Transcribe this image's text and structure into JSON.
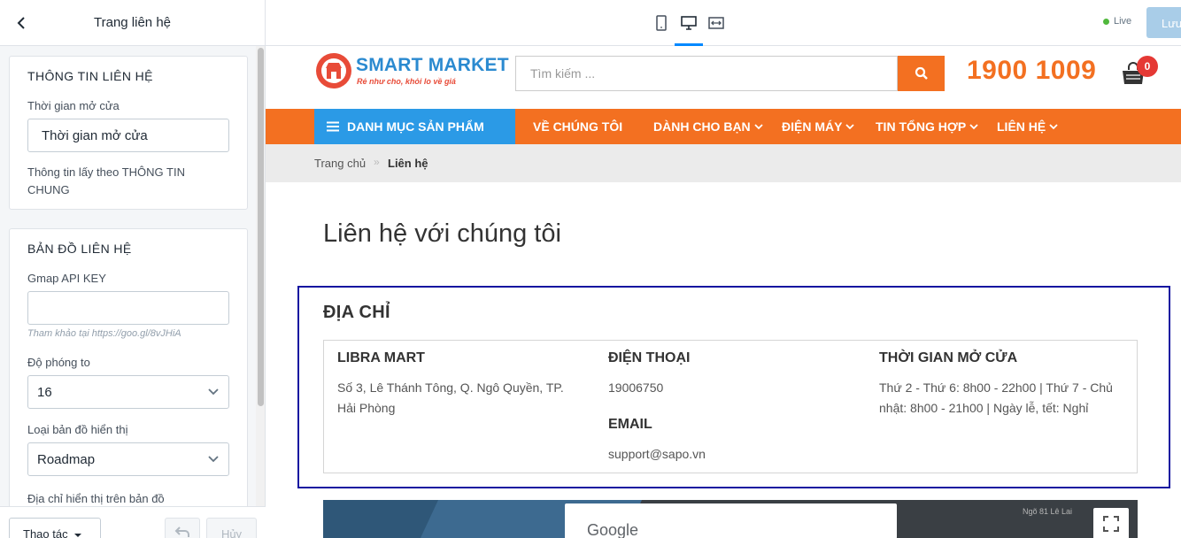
{
  "editor": {
    "header_title": "Trang liên hệ",
    "contact_info": {
      "title": "THÔNG TIN LIÊN HỆ",
      "opening_label": "Thời gian mở cửa",
      "opening_value": "Thời gian mở cửa",
      "help": "Thông tin lấy theo THÔNG TIN CHUNG"
    },
    "map": {
      "title": "BẢN ĐỒ LIÊN HỆ",
      "api_label": "Gmap API KEY",
      "api_value": "",
      "api_hint": "Tham khảo tại https://goo.gl/8vJHiA",
      "zoom_label": "Độ phóng to",
      "zoom_value": "16",
      "type_label": "Loại bản đồ hiển thị",
      "type_value": "Roadmap",
      "address_label": "Địa chỉ hiển thị trên bản đồ"
    },
    "footer": {
      "actions_label": "Thao tác",
      "cancel_label": "Hủy"
    }
  },
  "toolbar": {
    "live_label": "Live",
    "save_label": "Lưu"
  },
  "store": {
    "brand": "SMART MARKET",
    "tagline": "Rẻ như cho, khỏi lo về giá",
    "search_placeholder": "Tìm kiếm ...",
    "hotline": "1900 1009",
    "cart_count": "0",
    "nav": {
      "category": "DANH MỤC SẢN PHẨM",
      "items": [
        {
          "label": "VỀ CHÚNG TÔI"
        },
        {
          "label": "DÀNH CHO BẠN"
        },
        {
          "label": "ĐIỆN MÁY"
        },
        {
          "label": "TIN TỔNG HỢP"
        },
        {
          "label": "LIÊN HỆ"
        }
      ]
    },
    "breadcrumb": {
      "home": "Trang chủ",
      "separator": "»",
      "current": "Liên hệ"
    },
    "page_title": "Liên hệ với chúng tôi",
    "address": {
      "heading": "ĐỊA CHỈ",
      "store_name": "LIBRA MART",
      "store_address": "Số 3, Lê Thánh Tông, Q. Ngô Quyền, TP. Hải Phòng",
      "phone_heading": "ĐIỆN THOẠI",
      "phone": "19006750",
      "email_heading": "EMAIL",
      "email": "support@sapo.vn",
      "hours_heading": "THỜI GIAN MỞ CỬA",
      "hours": "Thứ 2 - Thứ 6: 8h00 - 22h00 | Thứ 7 - Chủ nhật: 8h00 - 21h00 | Ngày lễ, tết: Nghỉ"
    },
    "map": {
      "google_label": "Google",
      "street_label": "Ngõ 81 Lê Lai"
    }
  },
  "colors": {
    "accent": "#f37021",
    "brand_blue": "#2b9ae6",
    "highlight_border": "#1414a0"
  }
}
